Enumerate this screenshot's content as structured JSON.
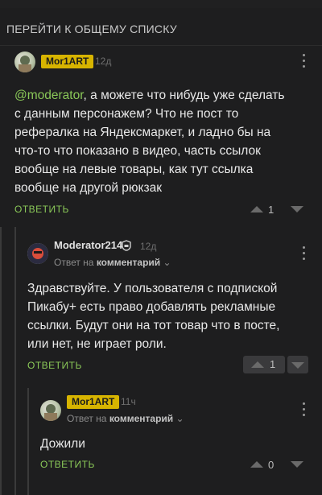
{
  "header": {
    "go_all": "ПЕРЕЙТИ К ОБЩЕМУ СПИСКУ"
  },
  "comments": [
    {
      "author": "Mor1ART",
      "time": "12д",
      "mention": "@moderator",
      "text_lines": [
        ", а можете что нибудь уже сделать",
        "с данным персонажем? Что не пост то",
        "рефералка на Яндексмаркет, и ладно бы на",
        "что-то что показано в видео, часть ссылок",
        "вообще на левые товары, как тут ссылка",
        "вообще на другой рюкзак"
      ],
      "reply_label": "ОТВЕТИТЬ",
      "score": "1"
    },
    {
      "author": "Moderator214",
      "time": "12д",
      "sub_prefix": "Ответ на",
      "sub_link": "комментарий",
      "text_lines": [
        "Здравствуйте. У пользователя с подпиской",
        "Пикабу+ есть право добавлять рекламные",
        "ссылки. Будут они на тот товар что в посте,",
        "или нет, не играет роли."
      ],
      "reply_label": "ОТВЕТИТЬ",
      "score": "1"
    },
    {
      "author": "Mor1ART",
      "time": "11ч",
      "sub_prefix": "Ответ на",
      "sub_link": "комментарий",
      "text_lines": [
        "Дожили"
      ],
      "reply_label": "ОТВЕТИТЬ",
      "score": "0"
    }
  ],
  "colors": {
    "accent_green": "#8ac858",
    "badge_yellow": "#d7b400",
    "background": "#1e1e1f"
  },
  "icons": [
    "kebab-menu-icon",
    "upvote-icon",
    "downvote-icon",
    "moderator-shield-icon",
    "chevron-down-icon"
  ]
}
